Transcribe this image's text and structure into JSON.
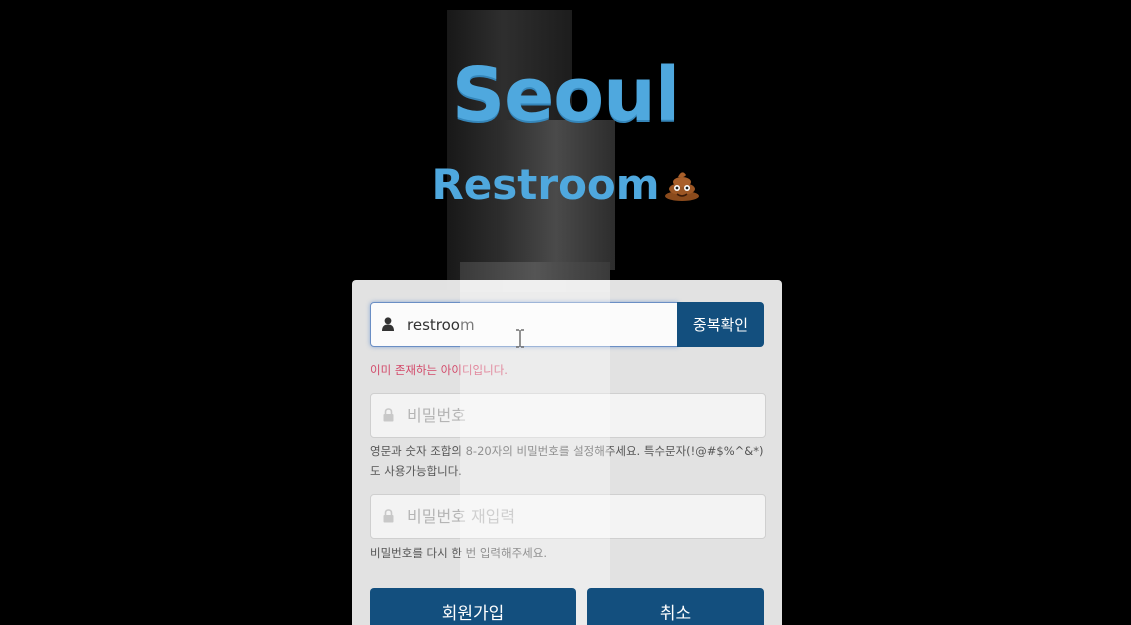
{
  "brand": {
    "title": "Seoul",
    "subtitle": "Restroom",
    "emoji_icon": "poo-icon",
    "color": "#4fa8de"
  },
  "signup": {
    "id_value": "restroom",
    "id_icon": "user-icon",
    "duplicate_check_label": "중복확인",
    "id_error": "이미 존재하는 아이디입니다.",
    "password_placeholder": "비밀번호",
    "password_icon": "lock-icon",
    "password_hint": "영문과 숫자 조합의 8-20자의 비밀번호를 설정해주세요. 특수문자(!@#$%^&*)도 사용가능합니다.",
    "password_confirm_placeholder": "비밀번호 재입력",
    "password_confirm_hint": "비밀번호를 다시 한 번 입력해주세요.",
    "join_label": "회원가입",
    "cancel_label": "취소"
  },
  "colors": {
    "primary_button": "#134f7e",
    "error_text": "#d34a6a"
  }
}
